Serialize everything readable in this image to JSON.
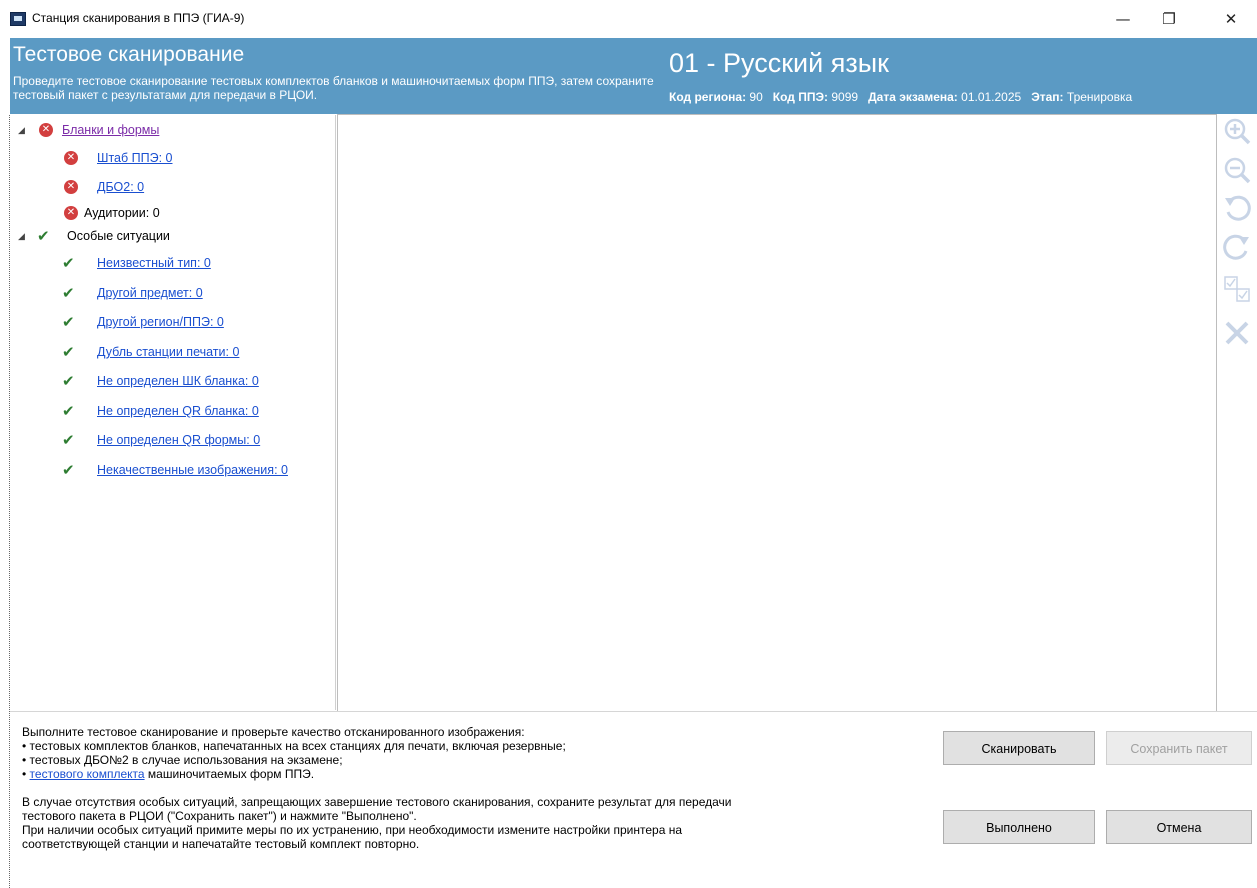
{
  "window": {
    "title": "Станция сканирования в ППЭ (ГИА-9)",
    "minimize": "—",
    "maximize": "❐",
    "close": "✕"
  },
  "header": {
    "title": "Тестовое сканирование",
    "description": "Проведите тестовое сканирование тестовых комплектов бланков и машиночитаемых форм ППЭ, затем сохраните тестовый пакет с результатами для передачи в РЦОИ.",
    "subject": "01 - Русский язык",
    "region_label": "Код региона:",
    "region_value": "90",
    "ppe_label": "Код ППЭ:",
    "ppe_value": "9099",
    "date_label": "Дата экзамена:",
    "date_value": "01.01.2025",
    "stage_label": "Этап:",
    "stage_value": "Тренировка"
  },
  "tree": {
    "group1": {
      "label": "Бланки и формы",
      "status": "error",
      "items": [
        {
          "label": "Штаб ППЭ: 0",
          "status": "error"
        },
        {
          "label": "ДБО2: 0",
          "status": "error"
        },
        {
          "label": "Аудитории: 0",
          "status": "error"
        }
      ]
    },
    "group2": {
      "label": "Особые ситуации",
      "status": "ok",
      "items": [
        {
          "label": "Неизвестный тип: 0",
          "status": "ok"
        },
        {
          "label": "Другой предмет: 0",
          "status": "ok"
        },
        {
          "label": "Другой регион/ППЭ: 0",
          "status": "ok"
        },
        {
          "label": "Дубль станции печати: 0",
          "status": "ok"
        },
        {
          "label": "Не определен ШК бланка: 0",
          "status": "ok"
        },
        {
          "label": "Не определен QR бланка: 0",
          "status": "ok"
        },
        {
          "label": "Не определен QR формы: 0",
          "status": "ok"
        },
        {
          "label": "Некачественные изображения: 0",
          "status": "ok"
        }
      ]
    }
  },
  "toolbar": {
    "zoom_in": "zoom-in-icon",
    "zoom_out": "zoom-out-icon",
    "rotate_left": "rotate-left-icon",
    "rotate_right": "rotate-right-icon",
    "check": "check-pages-icon",
    "delete": "delete-icon"
  },
  "instructions": {
    "line1": "Выполните тестовое сканирование и проверьте качество отсканированного изображения:",
    "bullet1": "• тестовых комплектов бланков, напечатанных на всех станциях для печати, включая резервные;",
    "bullet2": "• тестовых ДБО№2 в случае использования на экзамене;",
    "bullet3_prefix": "• ",
    "bullet3_link": "тестового комплекта",
    "bullet3_suffix": " машиночитаемых форм ППЭ.",
    "para2_line1": "В случае отсутствия особых ситуаций, запрещающих завершение тестового сканирования, сохраните результат для передачи",
    "para2_line2": "тестового пакета в РЦОИ (\"Сохранить пакет\") и нажмите \"Выполнено\".",
    "para2_line3": "При наличии особых ситуаций примите меры по их устранению, при необходимости измените настройки принтера на",
    "para2_line4": "соответствующей станции и напечатайте тестовый комплект повторно."
  },
  "buttons": {
    "scan": "Сканировать",
    "save_package": "Сохранить пакет",
    "done": "Выполнено",
    "cancel": "Отмена"
  },
  "colors": {
    "header_bg": "#5b9ac4",
    "link": "#1a4fd0",
    "error": "#d23f3f",
    "ok": "#2e7d32"
  }
}
